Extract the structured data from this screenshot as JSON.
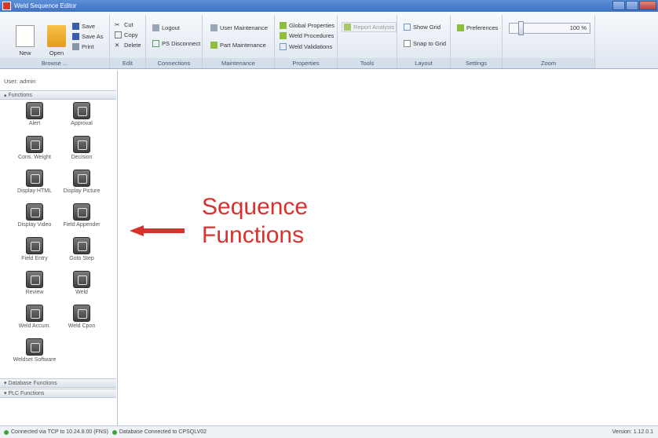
{
  "window": {
    "title": "Weld Sequence Editor"
  },
  "ribbon": {
    "browse": {
      "label": "Browse ...",
      "new": "New",
      "open": "Open",
      "save": "Save",
      "save_as": "Save As",
      "print": "Print"
    },
    "edit": {
      "label": "Edit",
      "cut": "Cut",
      "copy": "Copy",
      "delete": "Delete"
    },
    "connections": {
      "label": "Connections",
      "logout": "Logout",
      "ps_disconnect": "PS Disconnect"
    },
    "maintenance": {
      "label": "Maintenance",
      "user": "User Maintenance",
      "part": "Part Maintenance"
    },
    "properties": {
      "label": "Properties",
      "global": "Global Properties",
      "procedures": "Weld Procedures",
      "validations": "Weld Validations"
    },
    "tools": {
      "label": "Tools",
      "report": "Report Analysis"
    },
    "layout": {
      "label": "Layout",
      "show_grid": "Show Grid",
      "snap": "Snap to Grid"
    },
    "settings": {
      "label": "Settings",
      "preferences": "Preferences"
    },
    "zoom": {
      "label": "Zoom",
      "value": "100 %"
    }
  },
  "left_panel": {
    "user": "User: admin",
    "functions_header": "Functions",
    "functions": [
      "Alert",
      "Approval",
      "Cons. Weight",
      "Decision",
      "Display HTML",
      "Display Picture",
      "Display Video",
      "Field Appender",
      "Field Entry",
      "Goto Step",
      "Review",
      "Weld",
      "Weld Accum.",
      "Weld Cpon",
      "Weldset Software"
    ],
    "database_header": "Database Functions",
    "plc_header": "PLC Functions"
  },
  "canvas": {
    "annotation_line1": "Sequence",
    "annotation_line2": "Functions"
  },
  "status": {
    "tcp": "Connected via TCP to 10.24.8.00 (FNS)",
    "db": "Database Connected to CPSQLV02",
    "version": "Version: 1.12.0.1"
  },
  "colors": {
    "annotation": "#d8322f",
    "status_ok": "#3aa63a"
  }
}
